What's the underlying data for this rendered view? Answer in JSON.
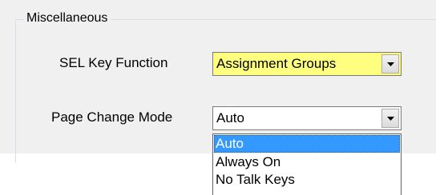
{
  "group": {
    "title": "Miscellaneous"
  },
  "sel_key_function": {
    "label": "SEL Key Function",
    "value": "Assignment Groups",
    "highlight_color": "#ffff80"
  },
  "page_change_mode": {
    "label": "Page Change Mode",
    "value": "Auto",
    "options": [
      "Auto",
      "Always On",
      "No Talk Keys"
    ],
    "selected_option": "Auto"
  },
  "colors": {
    "panel_bg": "#f0f0f0",
    "selection": "#3399ff"
  },
  "icons": {
    "dropdown_arrow": "chevron-down-icon"
  }
}
